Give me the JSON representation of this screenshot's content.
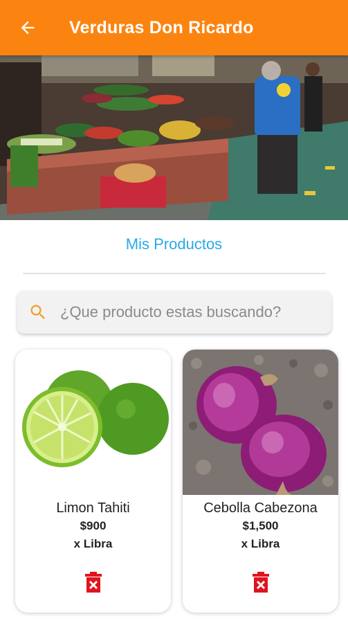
{
  "header": {
    "title": "Verduras Don Ricardo",
    "back_icon": "arrow-back-icon",
    "bg_color": "#fb8411"
  },
  "banner": {
    "image": "market-stall-photo"
  },
  "section": {
    "title": "Mis Productos",
    "color": "#29a9e6"
  },
  "search": {
    "placeholder": "¿Que producto estas buscando?",
    "icon": "search-icon",
    "icon_color": "#f0a030"
  },
  "products": [
    {
      "name": "Limon Tahiti",
      "price": "$900",
      "unit": "x Libra",
      "image": "limes-photo",
      "delete_icon": "trash-icon"
    },
    {
      "name": "Cebolla Cabezona",
      "price": "$1,500",
      "unit": "x Libra",
      "image": "red-onions-photo",
      "delete_icon": "trash-icon"
    }
  ],
  "colors": {
    "delete": "#e0141e"
  }
}
